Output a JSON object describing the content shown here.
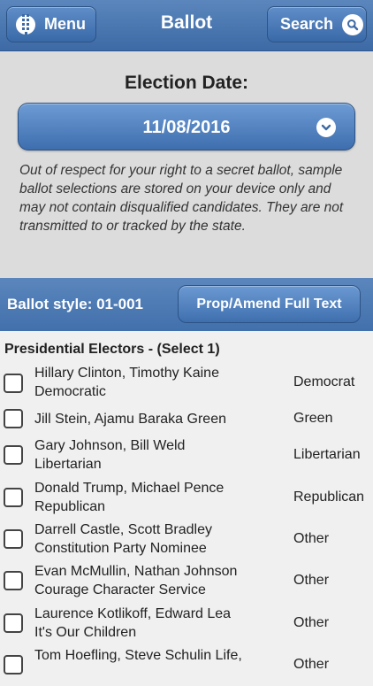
{
  "header": {
    "menu_label": "Menu",
    "title": "Ballot",
    "search_label": "Search"
  },
  "election": {
    "date_label": "Election Date:",
    "date_value": "11/08/2016",
    "notice": "Out of respect for your right to a secret ballot, sample ballot selections are stored on your device only and may not contain disqualified candidates. They are not transmitted to or tracked by the state."
  },
  "ballot": {
    "style_label": "Ballot style: 01-001",
    "prop_button": "Prop/Amend Full Text"
  },
  "race": {
    "title": "Presidential Electors -  (Select 1)",
    "candidates": [
      {
        "name": "Hillary Clinton, Timothy Kaine\nDemocratic",
        "party": "Democrat"
      },
      {
        "name": "Jill Stein, Ajamu Baraka Green",
        "party": "Green"
      },
      {
        "name": "Gary Johnson, Bill Weld\nLibertarian",
        "party": "Libertarian"
      },
      {
        "name": "Donald Trump, Michael Pence\nRepublican",
        "party": "Republican"
      },
      {
        "name": "Darrell Castle, Scott Bradley\nConstitution Party Nominee",
        "party": "Other"
      },
      {
        "name": "Evan McMullin, Nathan Johnson\nCourage Character Service",
        "party": "Other"
      },
      {
        "name": "Laurence Kotlikoff, Edward Lea\nIt's Our Children",
        "party": "Other"
      },
      {
        "name": "Tom Hoefling, Steve Schulin Life,",
        "party": "Other"
      }
    ]
  }
}
